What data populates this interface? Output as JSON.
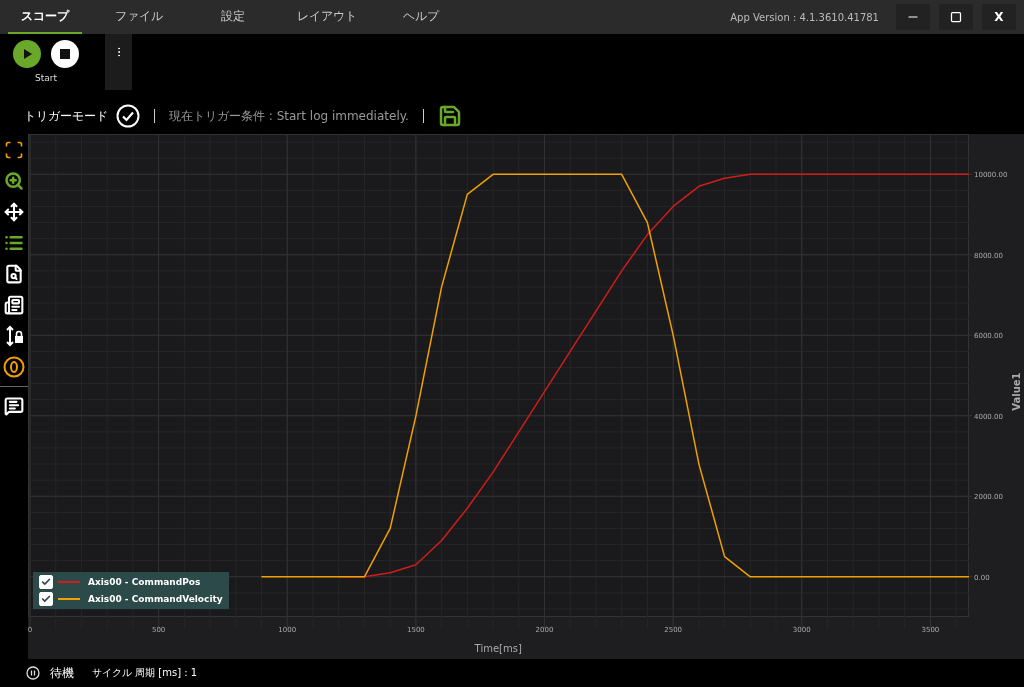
{
  "menu": {
    "tabs": [
      {
        "label": "スコープ",
        "selected": true
      },
      {
        "label": "ファイル",
        "selected": false
      },
      {
        "label": "設定",
        "selected": false
      },
      {
        "label": "レイアウト",
        "selected": false
      },
      {
        "label": "ヘルプ",
        "selected": false
      }
    ],
    "version": "App Version : 4.1.3610.41781",
    "close": "X"
  },
  "toolbar": {
    "start_label": "Start"
  },
  "trigger": {
    "label": "トリガーモード",
    "condition": "現在トリガー条件 : Start log immediately."
  },
  "chart": {
    "chart_data": {
      "type": "line",
      "xlabel": "Time[ms]",
      "ylabel": "Value1",
      "grid": true,
      "x": [
        900,
        1000,
        1100,
        1200,
        1300,
        1400,
        1500,
        1600,
        1700,
        1800,
        1900,
        2000,
        2100,
        2200,
        2300,
        2400,
        2500,
        2600,
        2700,
        2800,
        2900,
        3000,
        3100,
        3200,
        3300,
        3400,
        3500,
        3600,
        3650
      ],
      "series": [
        {
          "name": "Axis00 - CommandPos",
          "color": "#d01c1c",
          "values": [
            null,
            null,
            null,
            0,
            0,
            100,
            300,
            900,
            1700,
            2600,
            3600,
            4600,
            5600,
            6600,
            7600,
            8500,
            9200,
            9700,
            9900,
            10000,
            10000,
            10000,
            10000,
            10000,
            10000,
            10000,
            10000,
            10000,
            10000
          ]
        },
        {
          "name": "Axis00 - CommandVelocity",
          "color": "#f0a000",
          "values": [
            0,
            0,
            0,
            0,
            0,
            1200,
            4000,
            7200,
            9500,
            10000,
            10000,
            10000,
            10000,
            10000,
            10000,
            8800,
            6000,
            2800,
            500,
            0,
            0,
            0,
            0,
            0,
            0,
            0,
            0,
            0,
            0
          ]
        }
      ],
      "xlim": [
        0,
        3650
      ],
      "ylim": [
        -1000,
        11000
      ],
      "xticks": [
        0,
        500,
        1000,
        1500,
        2000,
        2500,
        3000,
        3500
      ],
      "yticks": [
        {
          "value": 0,
          "label": "0.00"
        },
        {
          "value": 2000,
          "label": "2000.00"
        },
        {
          "value": 4000,
          "label": "4000.00"
        },
        {
          "value": 6000,
          "label": "6000.00"
        },
        {
          "value": 8000,
          "label": "8000.00"
        },
        {
          "value": 10000,
          "label": "10000.00"
        }
      ]
    },
    "legend": [
      {
        "checked": true
      },
      {
        "checked": true
      }
    ]
  },
  "status": {
    "state": "待機",
    "cycle": "サイクル 周期 [ms] : 1"
  }
}
